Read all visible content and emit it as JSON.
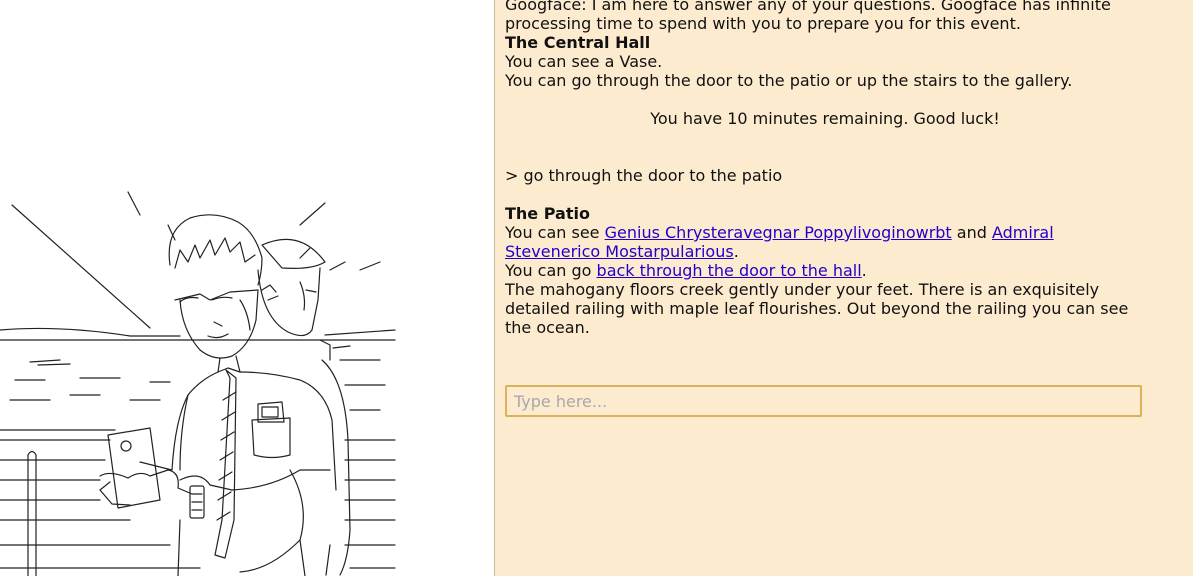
{
  "log": {
    "intro": "Googface: I am here to answer any of your questions. Googface has infinite processing time to spend with you to prepare you for this event.",
    "room1": {
      "title": "The Central Hall",
      "see": "You can see a Vase.",
      "exits": "You can go through the door to the patio or up the stairs to the gallery."
    },
    "timer": "You have 10 minutes remaining. Good luck!",
    "command": "> go through the door to the patio",
    "room2": {
      "title": "The Patio",
      "see_prefix": "You can see ",
      "person1": "Genius Chrysteravegnar Poppylivoginowrbt",
      "and": " and ",
      "person2": "Admiral Stevenerico Mostarpularious",
      "see_suffix": ".",
      "go_prefix": "You can go ",
      "go_link": "back through the door to the hall",
      "go_suffix": ".",
      "description": "The mahogany floors creek gently under your feet. There is an exquisitely detailed railing with maple leaf flourishes. Out beyond the railing you can see the ocean."
    }
  },
  "input": {
    "placeholder": "Type here..."
  },
  "colors": {
    "panel_bg": "#fdebd0",
    "input_border": "#d9b25e",
    "link": "#2200cc"
  }
}
